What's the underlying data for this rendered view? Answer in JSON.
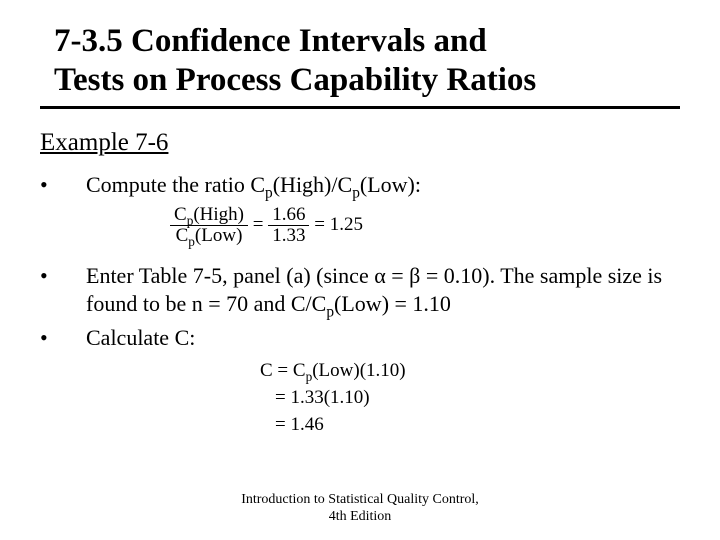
{
  "title_line1": "7-3.5 Confidence Intervals and",
  "title_line2": "Tests on Process Capability Ratios",
  "subhead": "Example 7-6",
  "bullets": {
    "b1_prefix": "Compute the ratio C",
    "b1_mid1": "(High)/C",
    "b1_suffix": "(Low):",
    "b2_a": "Enter Table 7-5, panel (a) (since ",
    "b2_b": " = ",
    "b2_c": " = 0.10). The sample size is found to be n = 70 and C/C",
    "b2_d": "(Low) = 1.10",
    "b3": "Calculate C:"
  },
  "greek": {
    "alpha": "α",
    "beta": "β"
  },
  "subp": "p",
  "eq1": {
    "num_a": "C",
    "num_b": "(High)",
    "den_a": "C",
    "den_b": "(Low)",
    "rhs_num": "1.66",
    "rhs_den": "1.33",
    "result": "1.25"
  },
  "eq2": {
    "line1_a": "C = C",
    "line1_b": "(Low)(1.10)",
    "line2": "= 1.33(1.10)",
    "line3": "= 1.46"
  },
  "footer_line1": "Introduction to Statistical Quality Control,",
  "footer_line2": "4th Edition",
  "bullet_char": "•"
}
